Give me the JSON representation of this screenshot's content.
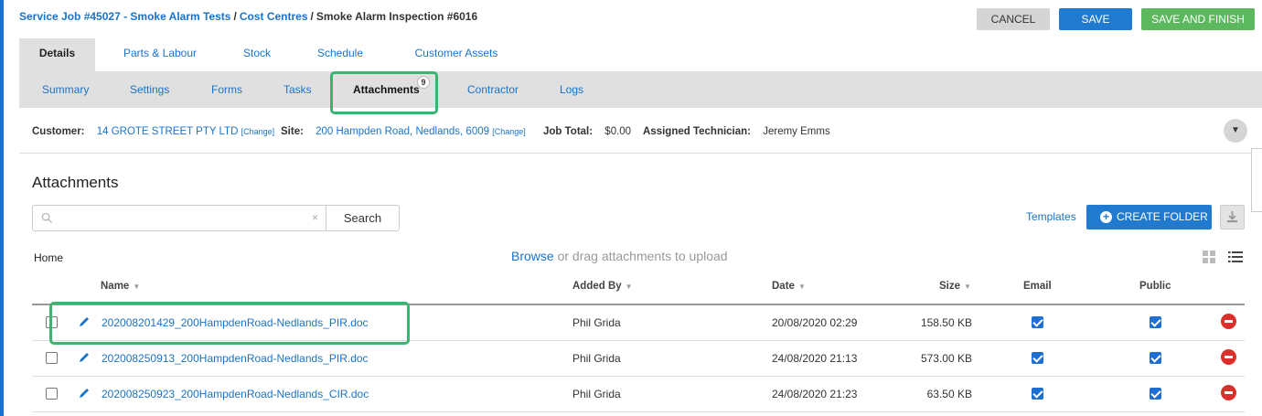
{
  "breadcrumb": {
    "job": "Service Job #45027 - Smoke Alarm Tests",
    "cost_centres": "Cost Centres",
    "current": "Smoke Alarm Inspection #6016",
    "separator": "/"
  },
  "actions": {
    "cancel": "CANCEL",
    "save": "SAVE",
    "save_finish": "SAVE AND FINISH"
  },
  "main_tabs": [
    {
      "label": "Details",
      "active": true
    },
    {
      "label": "Parts & Labour"
    },
    {
      "label": "Stock"
    },
    {
      "label": "Schedule"
    },
    {
      "label": "Customer Assets"
    }
  ],
  "sub_tabs": [
    {
      "label": "Summary"
    },
    {
      "label": "Settings"
    },
    {
      "label": "Forms"
    },
    {
      "label": "Tasks"
    },
    {
      "label": "Attachments",
      "active": true,
      "badge": "9"
    },
    {
      "label": "Contractor"
    },
    {
      "label": "Logs"
    }
  ],
  "info": {
    "customer_label": "Customer:",
    "customer": "14 GROTE STREET PTY LTD",
    "change": "[Change]",
    "site_label": "Site:",
    "site": "200 Hampden Road, Nedlands, 6009",
    "job_total_label": "Job Total:",
    "job_total": "$0.00",
    "technician_label": "Assigned Technician:",
    "technician": "Jeremy Emms",
    "collapse_icon": "▼"
  },
  "attachments": {
    "title": "Attachments",
    "search_placeholder": "",
    "search_button": "Search",
    "clear_icon": "×",
    "templates": "Templates",
    "create_folder": "CREATE FOLDER",
    "plus_icon": "+",
    "home": "Home",
    "browse": "Browse",
    "drag_text": " or drag attachments to upload"
  },
  "table": {
    "columns": {
      "name": "Name",
      "added_by": "Added By",
      "date": "Date",
      "size": "Size",
      "email": "Email",
      "public": "Public",
      "sort_arrow": "▼"
    },
    "rows": [
      {
        "name": "202008201429_200HampdenRoad-Nedlands_PIR.doc",
        "added_by": "Phil Grida",
        "date": "20/08/2020 02:29",
        "size": "158.50 KB",
        "email": true,
        "public": true
      },
      {
        "name": "202008250913_200HampdenRoad-Nedlands_PIR.doc",
        "added_by": "Phil Grida",
        "date": "24/08/2020 21:13",
        "size": "573.00 KB",
        "email": true,
        "public": true
      },
      {
        "name": "202008250923_200HampdenRoad-Nedlands_CIR.doc",
        "added_by": "Phil Grida",
        "date": "24/08/2020 21:23",
        "size": "63.50 KB",
        "email": true,
        "public": true
      }
    ]
  },
  "colors": {
    "link": "#1a73c8",
    "save": "#1f7ad0",
    "finish": "#5cb85c",
    "highlight": "#3cb371",
    "delete": "#d9302b"
  }
}
